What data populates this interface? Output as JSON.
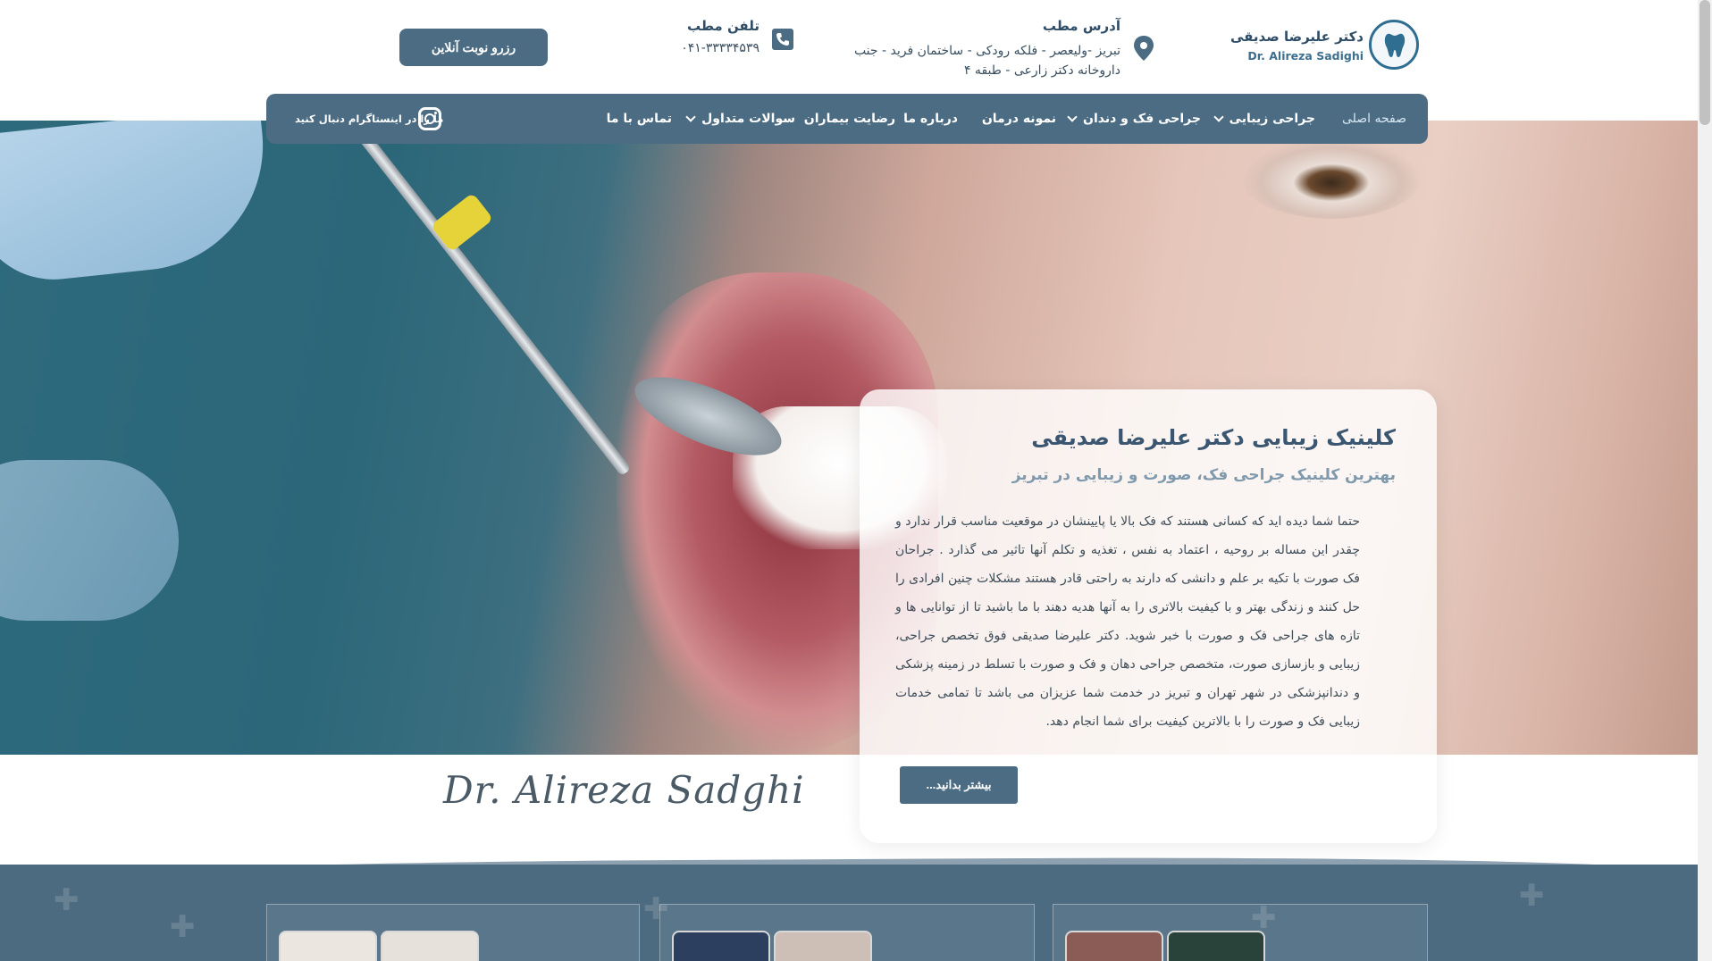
{
  "header": {
    "logo_fa": "دکتر علیرضا صدیقی",
    "logo_en": "Dr. Alireza Sadighi",
    "address_title": "آدرس مطب",
    "address_text": "تبریز -ولیعصر - فلکه رودکی - ساختمان فرید - جنب داروخانه دکتر زارعی - طبقه ۴",
    "phone_title": "تلفن مطب",
    "phone_number": "۰۴۱-۳۳۳۳۴۵۳۹",
    "reserve_label": "رزرو نوبت آنلاین"
  },
  "nav": {
    "items": [
      {
        "label": "صفحه اصلی",
        "active": true,
        "dropdown": false
      },
      {
        "label": "جراحی زیبایی",
        "active": false,
        "dropdown": true
      },
      {
        "label": "جراحی فک و دندان",
        "active": false,
        "dropdown": true
      },
      {
        "label": "نمونه درمان",
        "active": false,
        "dropdown": false
      },
      {
        "label": "درباره ما",
        "active": false,
        "dropdown": false
      },
      {
        "label": "رضایت بیماران",
        "active": false,
        "dropdown": false
      },
      {
        "label": "سوالات متداول",
        "active": false,
        "dropdown": true
      },
      {
        "label": "تماس با ما",
        "active": false,
        "dropdown": false
      }
    ],
    "instagram_label": "ما را در اینستاگرام دنبال کنید"
  },
  "hero": {
    "title": "کلینیک زیبایی دکتر علیرضا صدیقی",
    "subtitle": "بهترین کلینیک جراحی فک، صورت و زیبایی در تبریز",
    "body": "حتما شما دیده اید که کسانی هستند که فک بالا یا پایینشان در موقعیت مناسب قرار ندارد و چقدر این مساله بر روحیه ، اعتماد به نفس ، تغذیه و تکلم آنها تاثیر می گذارد . جراحان فک صورت با تکیه بر علم و دانشی که دارند به راحتی قادر هستند مشکلات چنین افرادی را حل کنند و زندگی بهتر و با کیفیت بالاتری را به آنها هدیه دهند با ما باشید تا از توانایی ها و تازه های جراحی فک و صورت با خبر شوید. دکتر علیرضا صدیقی فوق تخصص جراحی، زیبایی و بازسازی صورت، متخصص جراحی دهان و فک و صورت با تسلط در زمینه پزشکی و دندانپزشکی در شهر تهران و تبریز در خدمت شما عزیزان می باشد تا تمامی خدمات زیبایی فک و صورت را با بالاترین کیفیت برای شما انجام دهد.",
    "more_label": "بیشتر بدانید...",
    "signature": "Dr. Alireza Sadghi"
  },
  "colors": {
    "primary": "#4c6c83",
    "title_text": "#3a5670",
    "subtitle_text": "#7f99ad"
  }
}
